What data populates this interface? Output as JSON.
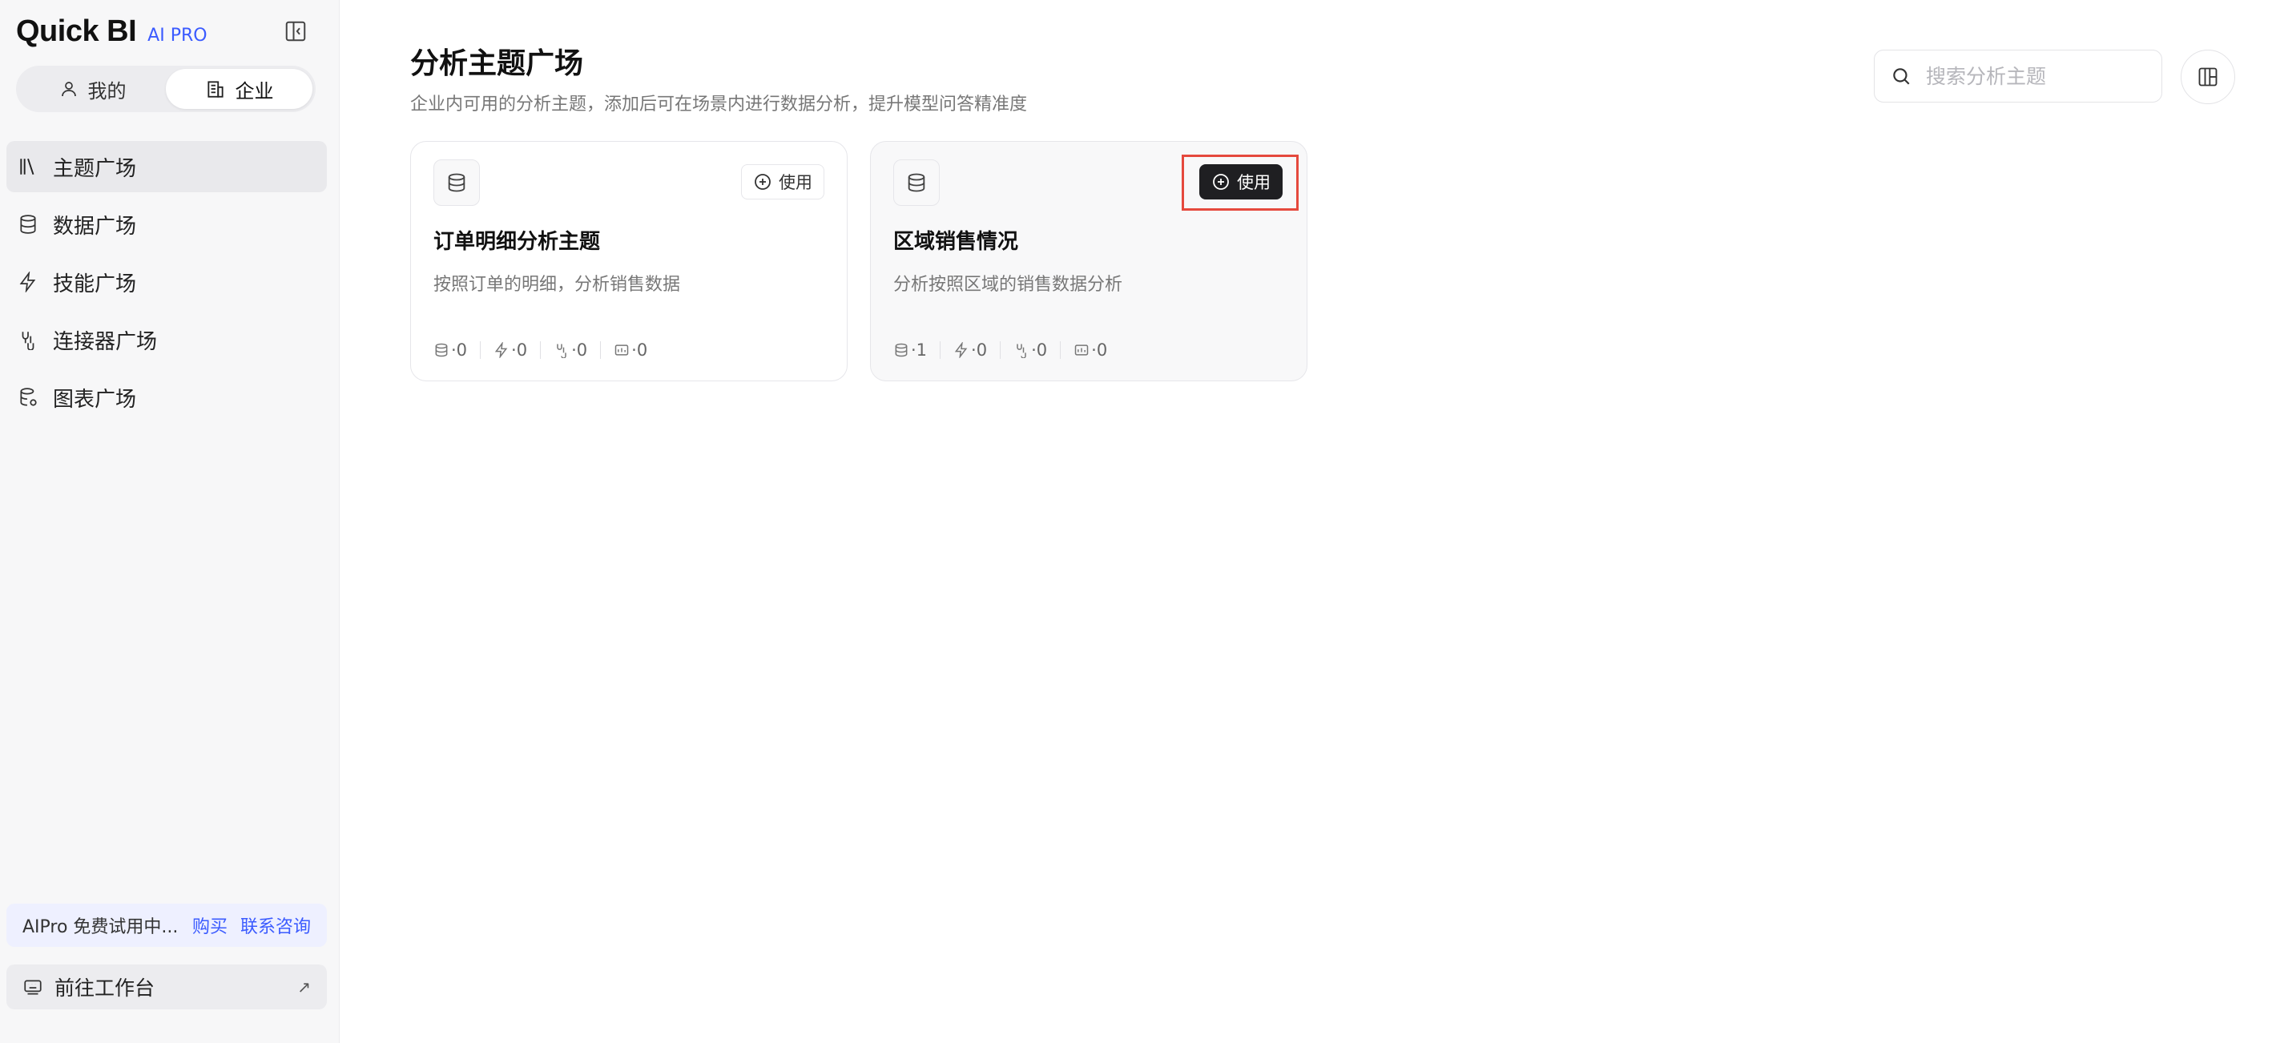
{
  "brand": {
    "name": "Quick BI",
    "badge": "AI PRO"
  },
  "switch": {
    "mine": "我的",
    "enterprise": "企业",
    "active": "enterprise"
  },
  "nav": [
    {
      "label": "主题广场",
      "icon": "library-icon",
      "active": true
    },
    {
      "label": "数据广场",
      "icon": "database-icon",
      "active": false
    },
    {
      "label": "技能广场",
      "icon": "lightning-icon",
      "active": false
    },
    {
      "label": "连接器广场",
      "icon": "connector-icon",
      "active": false
    },
    {
      "label": "图表广场",
      "icon": "chart-db-icon",
      "active": false
    }
  ],
  "trial": {
    "text": "AIPro 免费试用中...",
    "buy": "购买",
    "contact": "联系咨询"
  },
  "workbench": {
    "label": "前往工作台",
    "arrow": "↗"
  },
  "page": {
    "title": "分析主题广场",
    "subtitle": "企业内可用的分析主题，添加后可在场景内进行数据分析，提升模型问答精准度"
  },
  "search": {
    "placeholder": "搜索分析主题",
    "value": ""
  },
  "cards": [
    {
      "title": "订单明细分析主题",
      "desc": "按照订单的明细，分析销售数据",
      "use_label": "使用",
      "stats": {
        "data": "·0",
        "skills": "·0",
        "connectors": "·0",
        "charts": "·0"
      }
    },
    {
      "title": "区域销售情况",
      "desc": "分析按照区域的销售数据分析",
      "use_label": "使用",
      "stats": {
        "data": "·1",
        "skills": "·0",
        "connectors": "·0",
        "charts": "·0"
      }
    }
  ],
  "colors": {
    "accent": "#3b5bff",
    "highlight": "#e5493d",
    "dark_button": "#1f1f22"
  }
}
